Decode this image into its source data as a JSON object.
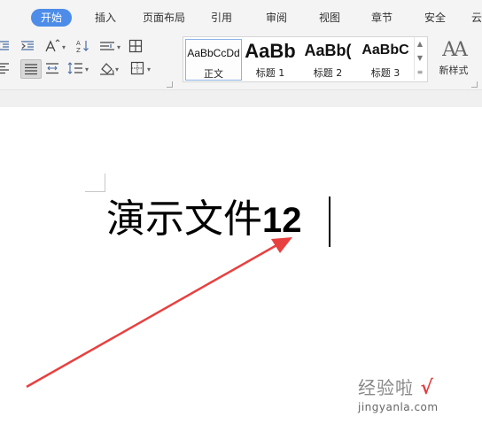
{
  "ribbon": {
    "tabs": [
      {
        "label": "开始",
        "active": true
      },
      {
        "label": "插入"
      },
      {
        "label": "页面布局"
      },
      {
        "label": "引用"
      },
      {
        "label": "审阅"
      },
      {
        "label": "视图"
      },
      {
        "label": "章节"
      },
      {
        "label": "安全"
      },
      {
        "label": "云"
      }
    ],
    "paragraph_tools": {
      "row1": [
        "decrease-indent-icon",
        "increase-indent-icon",
        "font-size-adjust-icon",
        "sort-icon",
        "spacing-icon",
        "table-grid-icon"
      ],
      "row2": [
        "align-left-icon",
        "align-center-icon",
        "distributed-icon",
        "line-spacing-icon",
        "shading-icon",
        "borders-icon"
      ]
    },
    "styles": [
      {
        "sample": "AaBbCcDd",
        "label": "正文",
        "current": true
      },
      {
        "sample": "AaBb",
        "label": "标题 1"
      },
      {
        "sample": "AaBb(",
        "label": "标题 2"
      },
      {
        "sample": "AaBbC",
        "label": "标题 3"
      }
    ],
    "new_style_icon": "AA",
    "new_style_label": "新样式"
  },
  "document": {
    "text_cjk": "演示文件",
    "text_num": "12"
  },
  "watermark": {
    "title": "经验啦",
    "check": "√",
    "url": "jingyanla.com"
  },
  "colors": {
    "accent": "#4d8ce8",
    "arrow": "#e84040"
  }
}
